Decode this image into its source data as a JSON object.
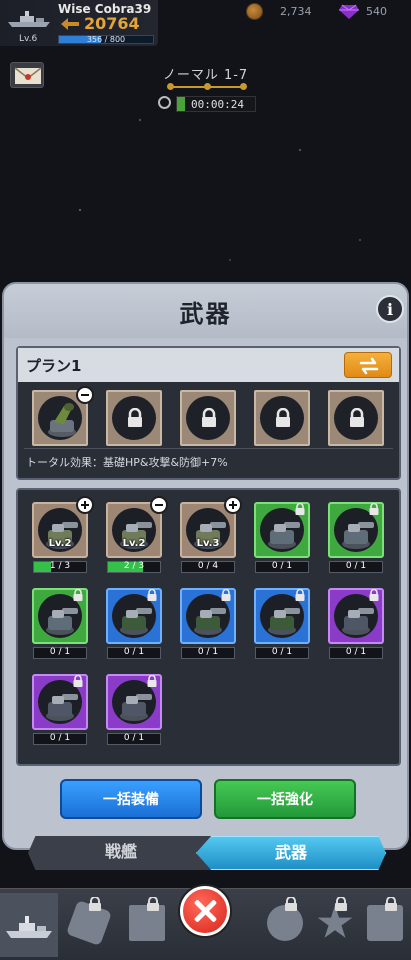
{
  "hud": {
    "player_name": "Wise Cobra39",
    "power": "20764",
    "level": "Lv.6",
    "exp_text": "356 / 800",
    "exp_fraction": 0.445,
    "coins": "2,734",
    "gems": "540"
  },
  "stage": {
    "name": "ノーマル 1-7",
    "timer": "00:00:24"
  },
  "panel": {
    "title": "武器",
    "info_label": "i",
    "plan_label": "プラン1",
    "total_effect": "トータル効果：基礎HP&攻撃&防御+7%",
    "bulk_equip": "一括装備",
    "bulk_upgrade": "一括強化"
  },
  "weapons": [
    {
      "level": "Lv.2",
      "count": "1 / 3",
      "fill": 0.333,
      "rarity": "brown",
      "badge": "plus"
    },
    {
      "level": "Lv.2",
      "count": "2 / 3",
      "fill": 0.667,
      "rarity": "brown",
      "badge": "minus"
    },
    {
      "level": "Lv.3",
      "count": "0 / 4",
      "fill": 0,
      "rarity": "brown",
      "badge": "plus"
    },
    {
      "level": "",
      "count": "0 / 1",
      "fill": 0,
      "rarity": "green",
      "badge": "lock"
    },
    {
      "level": "",
      "count": "0 / 1",
      "fill": 0,
      "rarity": "green",
      "badge": "lock"
    },
    {
      "level": "",
      "count": "0 / 1",
      "fill": 0,
      "rarity": "green",
      "badge": "lock"
    },
    {
      "level": "",
      "count": "0 / 1",
      "fill": 0,
      "rarity": "blue",
      "badge": "lock"
    },
    {
      "level": "",
      "count": "0 / 1",
      "fill": 0,
      "rarity": "blue",
      "badge": "lock"
    },
    {
      "level": "",
      "count": "0 / 1",
      "fill": 0,
      "rarity": "blue",
      "badge": "lock"
    },
    {
      "level": "",
      "count": "0 / 1",
      "fill": 0,
      "rarity": "purple",
      "badge": "lock"
    },
    {
      "level": "",
      "count": "0 / 1",
      "fill": 0,
      "rarity": "purple",
      "badge": "lock"
    },
    {
      "level": "",
      "count": "0 / 1",
      "fill": 0,
      "rarity": "purple",
      "badge": "lock"
    }
  ],
  "tabs": {
    "warship": "戦艦",
    "weapons": "武器"
  }
}
